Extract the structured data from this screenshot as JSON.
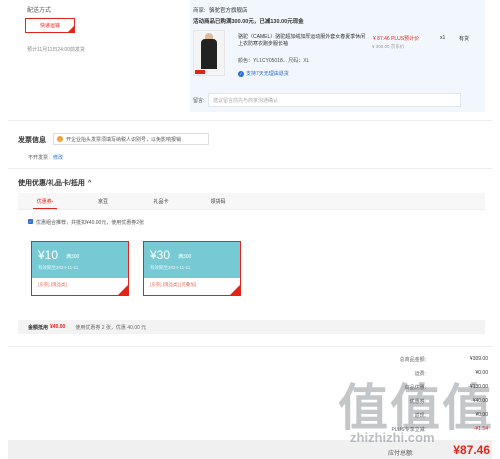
{
  "delivery": {
    "title": "配送方式",
    "express_button": "快递运输",
    "ship_date": "预计11月11日24:00前发货"
  },
  "merchant": {
    "label": "商家:",
    "name": "骆驼官方旗舰店",
    "promo": "活动商品已购满300.00元，已减130.00元现金",
    "product_title": "骆驼（CAMEL）骆驼超加绒加厚运动服外套女春夏季休闲上衣防寒衣跑步服长袖",
    "price": "¥ 87.46 PLUS预计价",
    "original_price": "¥ 300.00 京东价",
    "quantity": "x1",
    "stock": "有货",
    "spec": "颜色：YL1CY05018... 尺码：XL",
    "service": "支持7天无理由退货",
    "remark_label": "留言:",
    "remark_placeholder": "建议留言前先与商家沟通确认"
  },
  "invoice": {
    "title": "发票信息",
    "tip": "开企业抬头发票须填写纳税人识别号，以免影响报销",
    "status": "不开发票",
    "edit_link": "修改"
  },
  "coupons": {
    "section_title": "使用优惠/礼品卡/抵用",
    "tabs": [
      "优惠券",
      "京豆",
      "礼品卡",
      "领货码"
    ],
    "tab_badge": "*",
    "recommend_text": "优惠组合推荐，共抵扣¥40.00元，使用优惠券2张",
    "items": [
      {
        "amount": "¥10",
        "condition": "满300",
        "validity": "有效期至2024-11-11",
        "tags": "[东券] [限品类]"
      },
      {
        "amount": "¥30",
        "condition": "满300",
        "validity": "有效期至2024-11-11",
        "tags": "[东券] [限品类] [可叠加]"
      }
    ],
    "discount_label": "金额抵用",
    "discount_value": "¥40.00",
    "discount_detail": "使用优惠券 2 张，优惠 40.00 元"
  },
  "summary": {
    "rows": [
      {
        "label": "总商品金额:",
        "value": "¥309.00"
      },
      {
        "label": "运费:",
        "value": "¥0.00"
      },
      {
        "label": "商品优惠:",
        "value": "-¥130.00"
      },
      {
        "label": "优惠券:",
        "value": "-¥40.00"
      },
      {
        "label": "返现:",
        "value": "¥0.00"
      },
      {
        "label": "PLUS专享立减:",
        "value": "-¥1.54"
      }
    ],
    "total_label": "应付总额:",
    "total_value": "¥87.46"
  },
  "colors": {
    "accent": "#e2231a",
    "coupon": "#77cad3",
    "panel": "#f1f7fc"
  }
}
